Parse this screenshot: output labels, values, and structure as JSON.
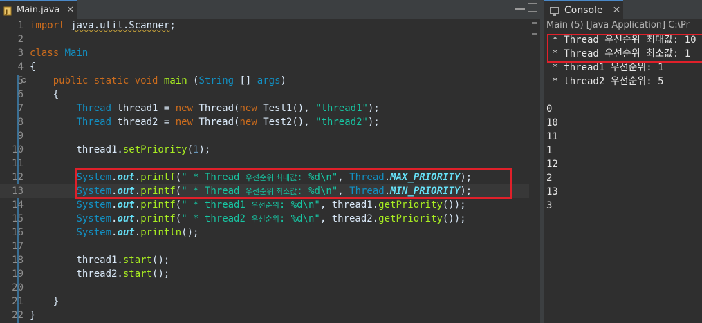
{
  "editor": {
    "tab_label": "Main.java",
    "tab_close": "✕",
    "lines": [
      {
        "n": "1",
        "seg": [
          [
            "kw",
            "import"
          ],
          [
            "plain",
            " "
          ],
          [
            "squig",
            "java.util.Scanner"
          ],
          [
            "plain",
            ";"
          ]
        ]
      },
      {
        "n": "2",
        "seg": []
      },
      {
        "n": "3",
        "seg": [
          [
            "kw",
            "class"
          ],
          [
            "plain",
            " "
          ],
          [
            "cls",
            "Main"
          ]
        ]
      },
      {
        "n": "4",
        "seg": [
          [
            "plain",
            "{"
          ]
        ]
      },
      {
        "n": "5",
        "seg": [
          [
            "plain",
            "    "
          ],
          [
            "kw",
            "public"
          ],
          [
            "plain",
            " "
          ],
          [
            "kw",
            "static"
          ],
          [
            "plain",
            " "
          ],
          [
            "kw",
            "void"
          ],
          [
            "plain",
            " "
          ],
          [
            "mth",
            "main"
          ],
          [
            "plain",
            " ("
          ],
          [
            "ty",
            "String"
          ],
          [
            "plain",
            " [] "
          ],
          [
            "ty",
            "args"
          ],
          [
            "plain",
            ")"
          ]
        ]
      },
      {
        "n": "6",
        "seg": [
          [
            "plain",
            "    {"
          ]
        ]
      },
      {
        "n": "7",
        "seg": [
          [
            "plain",
            "        "
          ],
          [
            "ty",
            "Thread"
          ],
          [
            "plain",
            " thread1 = "
          ],
          [
            "kw",
            "new"
          ],
          [
            "plain",
            " Thread("
          ],
          [
            "kw",
            "new"
          ],
          [
            "plain",
            " Test1(), "
          ],
          [
            "str",
            "\"thread1\""
          ],
          [
            "plain",
            ");"
          ]
        ]
      },
      {
        "n": "8",
        "seg": [
          [
            "plain",
            "        "
          ],
          [
            "ty",
            "Thread"
          ],
          [
            "plain",
            " thread2 = "
          ],
          [
            "kw",
            "new"
          ],
          [
            "plain",
            " Thread("
          ],
          [
            "kw",
            "new"
          ],
          [
            "plain",
            " Test2(), "
          ],
          [
            "str",
            "\"thread2\""
          ],
          [
            "plain",
            ");"
          ]
        ]
      },
      {
        "n": "9",
        "seg": []
      },
      {
        "n": "10",
        "seg": [
          [
            "plain",
            "        thread1."
          ],
          [
            "mth",
            "setPriority"
          ],
          [
            "plain",
            "("
          ],
          [
            "num-lit",
            "1"
          ],
          [
            "plain",
            ");"
          ]
        ]
      },
      {
        "n": "11",
        "seg": []
      },
      {
        "n": "12",
        "seg": [
          [
            "plain",
            "        "
          ],
          [
            "ty",
            "System"
          ],
          [
            "plain",
            "."
          ],
          [
            "fld",
            "out"
          ],
          [
            "plain",
            "."
          ],
          [
            "mth",
            "printf"
          ],
          [
            "plain",
            "("
          ],
          [
            "str",
            "\" * Thread "
          ],
          [
            "str ko",
            "우선순위 최대값"
          ],
          [
            "str",
            ": %d\\n\""
          ],
          [
            "plain",
            ", "
          ],
          [
            "ty",
            "Thread"
          ],
          [
            "plain",
            "."
          ],
          [
            "fld",
            "MAX_PRIORITY"
          ],
          [
            "plain",
            ");"
          ]
        ]
      },
      {
        "n": "13",
        "seg": [
          [
            "plain",
            "        "
          ],
          [
            "ty",
            "System"
          ],
          [
            "plain",
            "."
          ],
          [
            "fld",
            "out"
          ],
          [
            "plain",
            "."
          ],
          [
            "mth",
            "printf"
          ],
          [
            "plain",
            "("
          ],
          [
            "str",
            "\" * Thread "
          ],
          [
            "str ko",
            "우선순위 최소값"
          ],
          [
            "str",
            ": %d\\"
          ],
          [
            "caret",
            ""
          ],
          [
            "str",
            "n\""
          ],
          [
            "plain",
            ", "
          ],
          [
            "ty",
            "Thread"
          ],
          [
            "plain",
            "."
          ],
          [
            "fld",
            "MIN_PRIORITY"
          ],
          [
            "plain",
            ");"
          ]
        ]
      },
      {
        "n": "14",
        "seg": [
          [
            "plain",
            "        "
          ],
          [
            "ty",
            "System"
          ],
          [
            "plain",
            "."
          ],
          [
            "fld",
            "out"
          ],
          [
            "plain",
            "."
          ],
          [
            "mth",
            "printf"
          ],
          [
            "plain",
            "("
          ],
          [
            "str",
            "\" * thread1 "
          ],
          [
            "str ko",
            "우선순위"
          ],
          [
            "str",
            ": %d\\n\""
          ],
          [
            "plain",
            ", thread1."
          ],
          [
            "mth",
            "getPriority"
          ],
          [
            "plain",
            "());"
          ]
        ]
      },
      {
        "n": "15",
        "seg": [
          [
            "plain",
            "        "
          ],
          [
            "ty",
            "System"
          ],
          [
            "plain",
            "."
          ],
          [
            "fld",
            "out"
          ],
          [
            "plain",
            "."
          ],
          [
            "mth",
            "printf"
          ],
          [
            "plain",
            "("
          ],
          [
            "str",
            "\" * thread2 "
          ],
          [
            "str ko",
            "우선순위"
          ],
          [
            "str",
            ": %d\\n\""
          ],
          [
            "plain",
            ", thread2."
          ],
          [
            "mth",
            "getPriority"
          ],
          [
            "plain",
            "());"
          ]
        ]
      },
      {
        "n": "16",
        "seg": [
          [
            "plain",
            "        "
          ],
          [
            "ty",
            "System"
          ],
          [
            "plain",
            "."
          ],
          [
            "fld",
            "out"
          ],
          [
            "plain",
            "."
          ],
          [
            "mth",
            "println"
          ],
          [
            "plain",
            "();"
          ]
        ]
      },
      {
        "n": "17",
        "seg": []
      },
      {
        "n": "18",
        "seg": [
          [
            "plain",
            "        thread1."
          ],
          [
            "mth",
            "start"
          ],
          [
            "plain",
            "();"
          ]
        ]
      },
      {
        "n": "19",
        "seg": [
          [
            "plain",
            "        thread2."
          ],
          [
            "mth",
            "start"
          ],
          [
            "plain",
            "();"
          ]
        ]
      },
      {
        "n": "20",
        "seg": []
      },
      {
        "n": "21",
        "seg": [
          [
            "plain",
            "    }"
          ]
        ]
      },
      {
        "n": "22",
        "seg": [
          [
            "plain",
            "}"
          ]
        ]
      }
    ]
  },
  "console": {
    "tab_label": "Console",
    "tab_close": "✕",
    "description": "Main (5) [Java Application] C:\\Pr",
    "output": [
      " * Thread 우선순위 최대값: 10",
      " * Thread 우선순위 최소값: 1",
      " * thread1 우선순위: 1",
      " * thread2 우선순위: 5",
      "",
      "0",
      "10",
      "11",
      "1",
      "12",
      "2",
      "13",
      "3"
    ]
  },
  "colors": {
    "highlight_box": "#e0202a",
    "keyword": "#cc6c1d",
    "type": "#1290c3",
    "string": "#17c6a3",
    "method": "#a7ec21",
    "field": "#66e1f8"
  }
}
